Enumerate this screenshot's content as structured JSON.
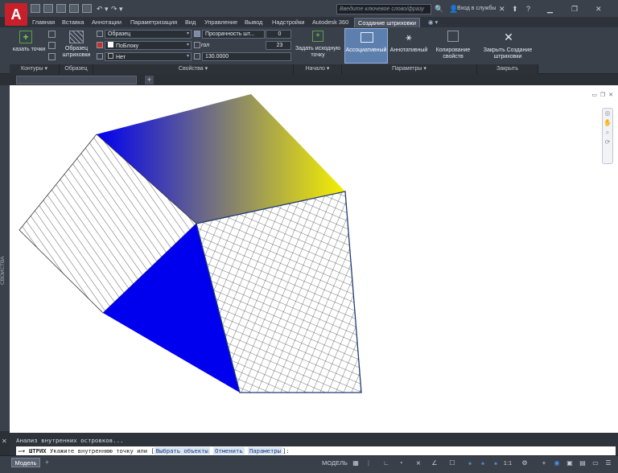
{
  "title_bar": {
    "search_placeholder": "Введите ключевое слово/фразу",
    "sign_in": "Вход в службы",
    "help": "?"
  },
  "ribbon_tabs": [
    {
      "label": "Главная"
    },
    {
      "label": "Вставка"
    },
    {
      "label": "Аннотации"
    },
    {
      "label": "Параметризация"
    },
    {
      "label": "Вид"
    },
    {
      "label": "Управление"
    },
    {
      "label": "Вывод"
    },
    {
      "label": "Надстройки"
    },
    {
      "label": "Autodesk 360"
    },
    {
      "label": "Создание штриховки"
    }
  ],
  "ribbon": {
    "contours": {
      "pick_points": "казать точки",
      "panel": "Контуры"
    },
    "pattern": {
      "button": "Образец штриховки",
      "panel": "Образец"
    },
    "properties": {
      "hatch_type": "Образец",
      "color": "ПоБлоку",
      "background": "Нет",
      "transparency_label": "Прозрачность шт...",
      "transparency_value": "0",
      "angle_label": "гол",
      "angle_value": "23",
      "scale_value": "130.0000",
      "panel": "Свойства"
    },
    "origin": {
      "set_origin": "Задать исходную точку",
      "panel": "Начало"
    },
    "options": {
      "associative": "Ассоциативный",
      "annotative": "Аннотативный",
      "match_properties": "Копирование свойств",
      "panel": "Параметры"
    },
    "close": {
      "button": "Закрыть Создание штриховки",
      "panel": "Закрыть"
    }
  },
  "side_palette": {
    "label": "СВОЙСТВА"
  },
  "command": {
    "history": "Анализ внутренних островков...",
    "name": "ШТРИХ",
    "prompt": "Укажите внутреннюю точку или",
    "option_select": "Выбрать объекты",
    "option_undo": "Отменить",
    "option_params": "Параметры",
    "suffix": "]:"
  },
  "status": {
    "model_tab": "Модель",
    "model_label": "МОДЕЛЬ",
    "scale": "1:1"
  },
  "colors": {
    "gradient_blue": "#0000f0",
    "gradient_yellow": "#f6f000",
    "solid_blue": "#0000ee",
    "hatch_stroke": "#1a1a1a",
    "outline": "#223a70"
  }
}
